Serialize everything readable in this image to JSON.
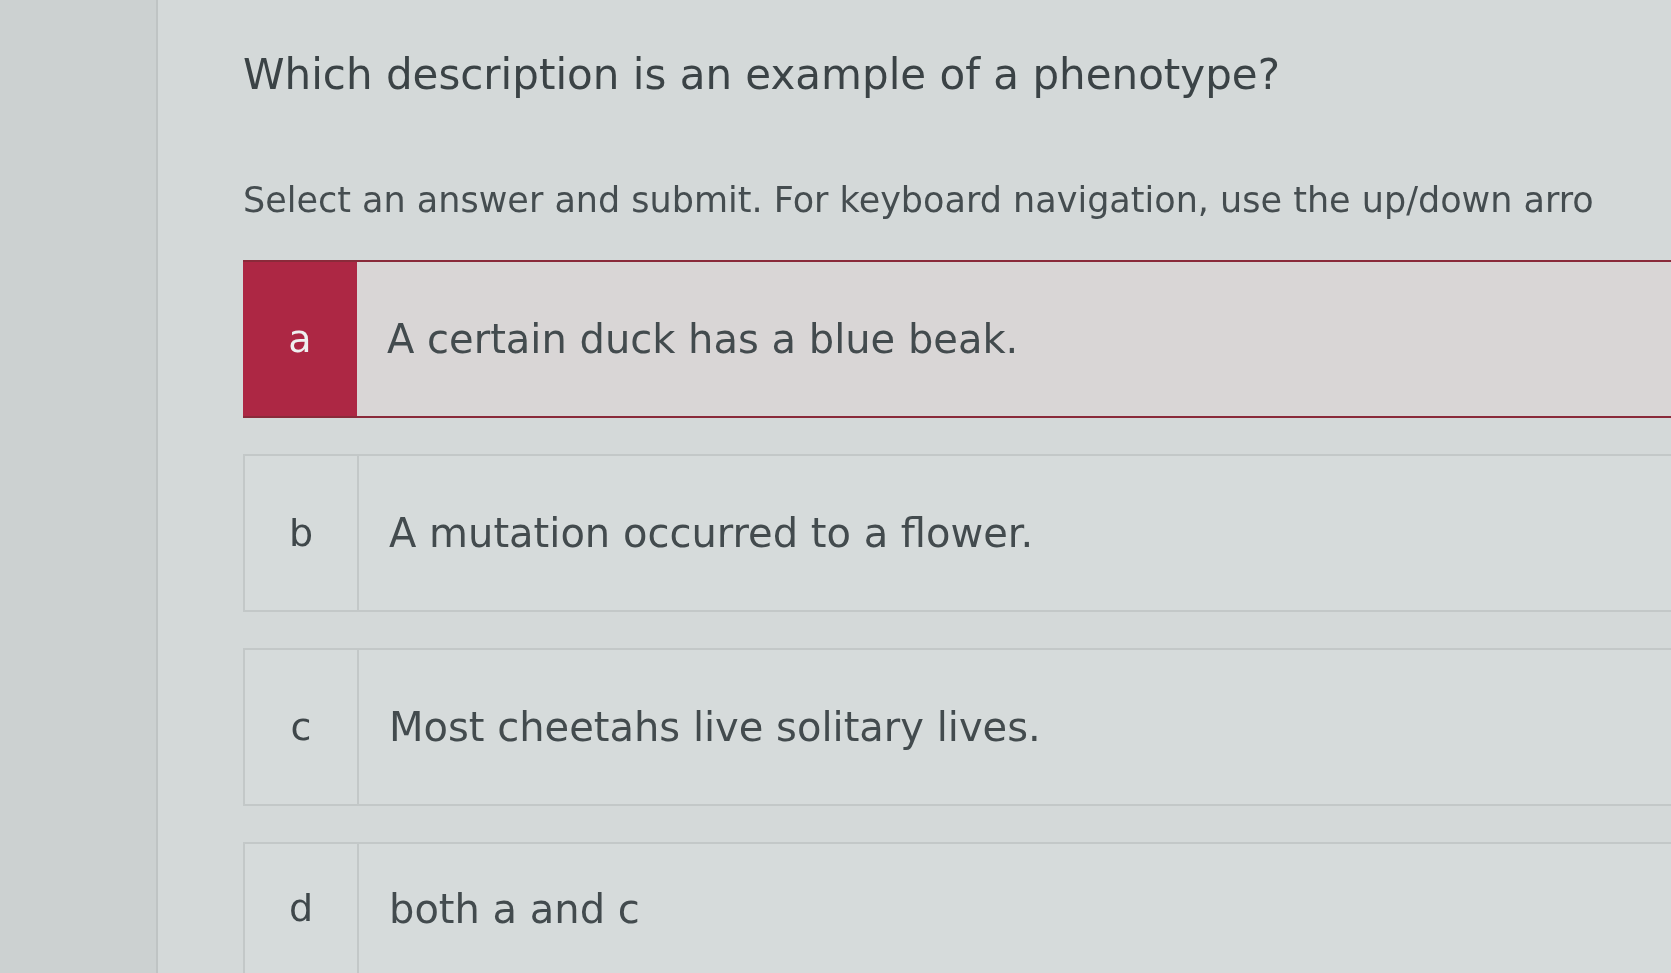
{
  "question": "Which description is an example of a phenotype?",
  "instructions": "Select an answer and submit. For keyboard navigation, use the up/down arro",
  "options": [
    {
      "letter": "a",
      "text": "A certain duck has a blue beak.",
      "selected": true
    },
    {
      "letter": "b",
      "text": "A mutation occurred to a flower.",
      "selected": false
    },
    {
      "letter": "c",
      "text": "Most cheetahs live solitary lives.",
      "selected": false
    },
    {
      "letter": "d",
      "text": "both a and c",
      "selected": false
    }
  ]
}
